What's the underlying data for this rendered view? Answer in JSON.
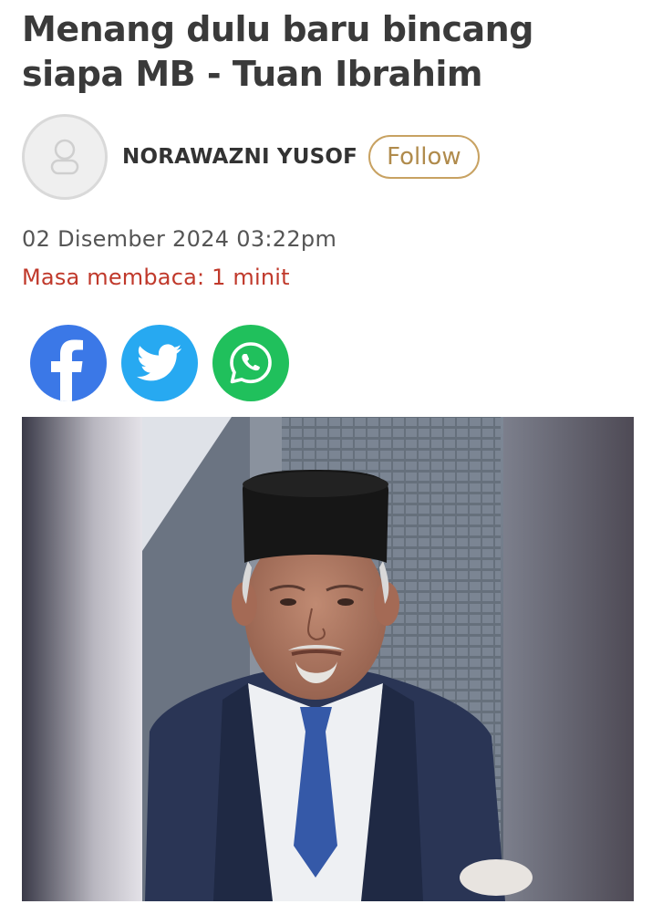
{
  "article": {
    "headline_line1": "Menang dulu baru bincang",
    "headline_line2": "siapa MB - Tuan Ibrahim",
    "author": "NORAWAZNI YUSOF",
    "follow_label": "Follow",
    "date": "02 Disember 2024 03:22pm",
    "reading_time": "Masa membaca: 1 minit"
  },
  "share": {
    "icons": [
      "facebook-icon",
      "twitter-icon",
      "whatsapp-icon"
    ]
  },
  "colors": {
    "headline": "#3a3a3a",
    "follow_border": "#c8a262",
    "reading_time": "#c0392b",
    "facebook": "#3b78e7",
    "twitter": "#27a9f1",
    "whatsapp": "#20c05c"
  }
}
